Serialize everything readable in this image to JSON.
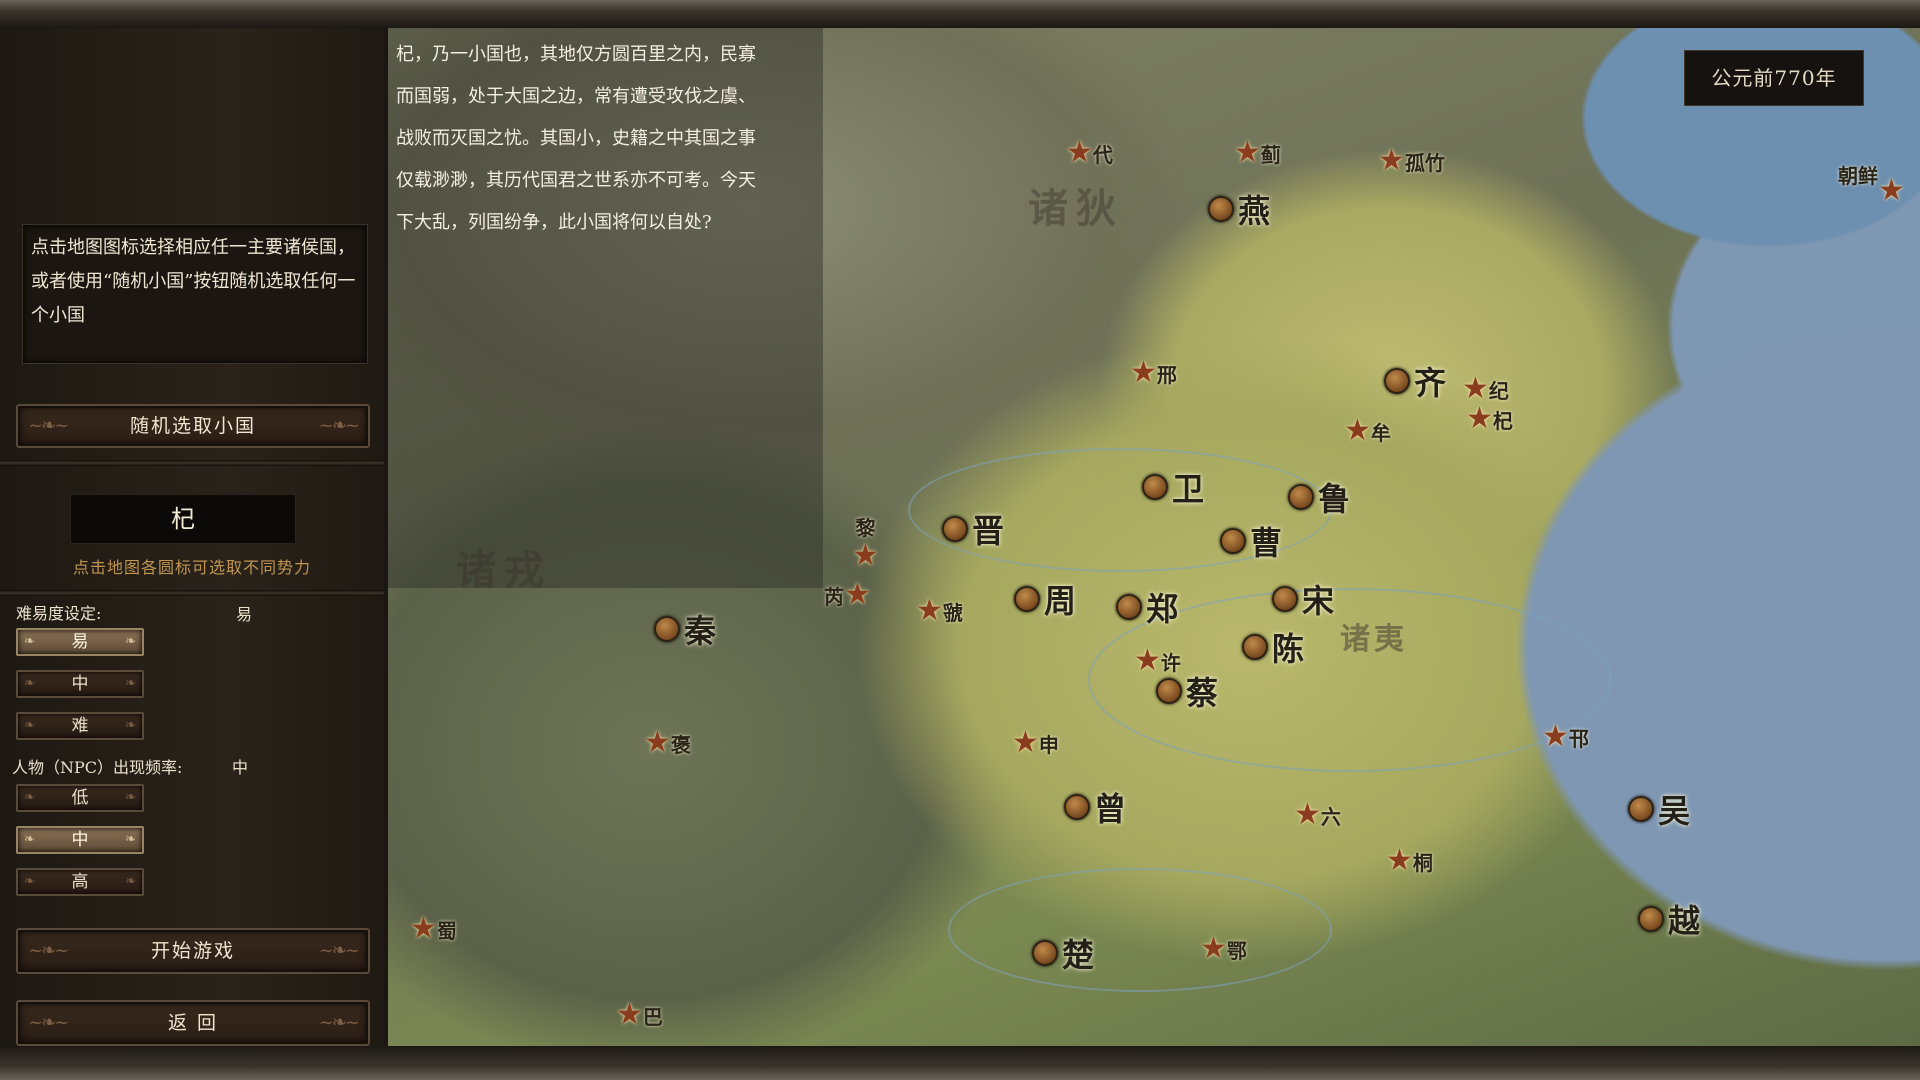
{
  "left_panel": {
    "instruction": "点击地图图标选择相应任一主要诸侯国，或者使用“随机小国”按钮随机选取任何一个小国",
    "random_button": "随机选取小国",
    "selected_faction": "杞",
    "faction_hint": "点击地图各圆标可选取不同势力",
    "difficulty": {
      "label": "难易度设定:",
      "current": "易",
      "options": [
        "易",
        "中",
        "难"
      ],
      "selected_index": 0
    },
    "npc_frequency": {
      "label": "人物（NPC）出现频率:",
      "current": "中",
      "options": [
        "低",
        "中",
        "高"
      ],
      "selected_index": 1
    },
    "start_button": "开始游戏",
    "back_button": "返 回"
  },
  "info_text": [
    "杞，乃一小国也，其地仅方圆百里之内，民寡",
    "而国弱，处于大国之边，常有遭受攻伐之虞、",
    "战败而灭国之忧。其国小，史籍之中其国之事",
    "仅载渺渺，其历代国君之世系亦不可考。今天",
    "下大乱，列国纷争，此小国将何以自处?"
  ],
  "year": "公元前770年",
  "regions": [
    "诸狄",
    "诸戎",
    "诸夷"
  ],
  "major_states": [
    "燕",
    "齐",
    "卫",
    "鲁",
    "晋",
    "曹",
    "周",
    "郑",
    "宋",
    "秦",
    "陈",
    "蔡",
    "曾",
    "楚",
    "吴",
    "越"
  ],
  "minor_states": [
    "代",
    "蓟",
    "孤竹",
    "朝鲜",
    "邢",
    "纪",
    "杞",
    "牟",
    "黎",
    "芮",
    "虢",
    "许",
    "申",
    "褒",
    "邗",
    "六",
    "桐",
    "蜀",
    "鄂",
    "巴"
  ],
  "colors": {
    "state_marker": "#9a6430",
    "minor_star": "#8a3d1e",
    "hint_text": "#c09552",
    "selected_button": "#8a7256"
  }
}
